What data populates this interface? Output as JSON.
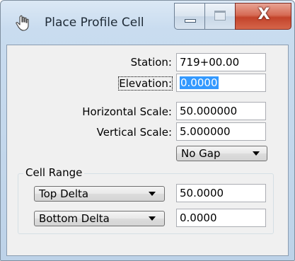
{
  "window": {
    "title": "Place Profile Cell",
    "close_glyph": "X"
  },
  "fields": {
    "station": {
      "label": "Station:",
      "value": "719+00.00"
    },
    "elevation": {
      "label": "Elevation:",
      "value": "0.0000"
    },
    "horizontal_scale": {
      "label": "Horizontal Scale:",
      "value": "50.000000"
    },
    "vertical_scale": {
      "label": "Vertical Scale:",
      "value": "5.000000"
    }
  },
  "gap_dropdown": {
    "selected": "No Gap"
  },
  "cell_range": {
    "title": "Cell Range",
    "top": {
      "selected": "Top Delta",
      "value": "50.0000"
    },
    "bottom": {
      "selected": "Bottom Delta",
      "value": "0.0000"
    }
  },
  "icons": {
    "app": "hand-pointer-icon",
    "minimize": "minimize-icon",
    "maximize": "maximize-icon",
    "close": "close-icon"
  },
  "colors": {
    "selection": "#3399ff",
    "close_button": "#c3432b",
    "title_text": "#1e2a36"
  }
}
